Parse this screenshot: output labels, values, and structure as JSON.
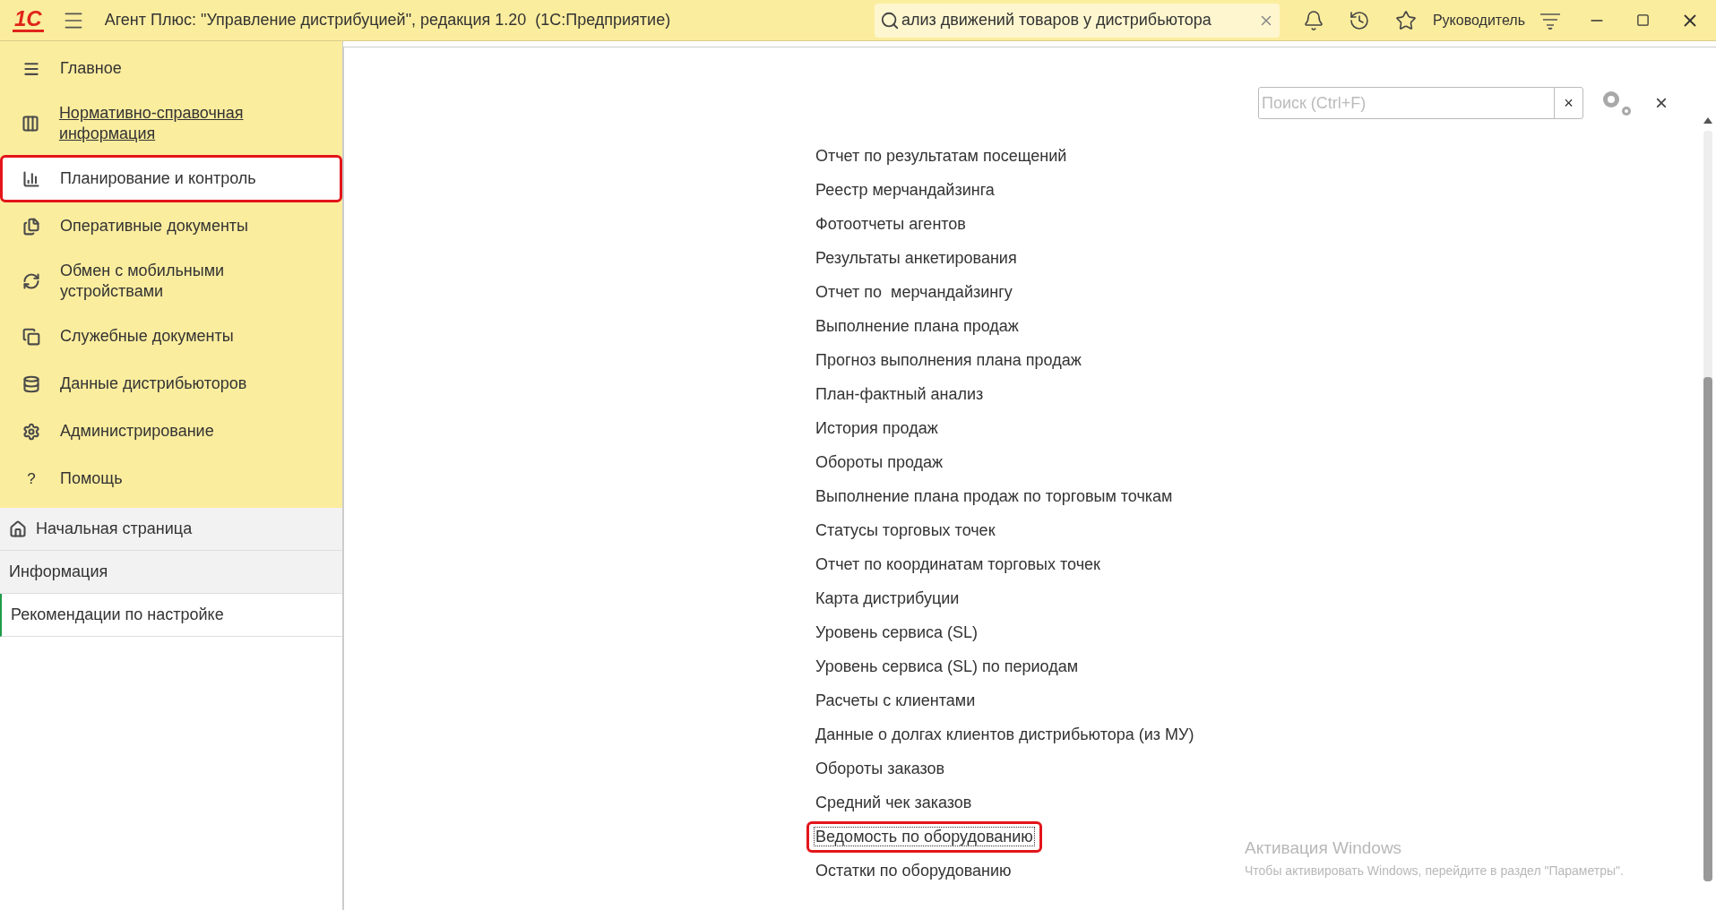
{
  "window": {
    "logo": "1С",
    "title": "Агент Плюс: \"Управление дистрибуцией\", редакция 1.20  (1С:Предприятие)",
    "search_value": "ализ движений товаров у дистрибьютора",
    "user": "Руководитель"
  },
  "sidebar": {
    "sections": [
      {
        "label": "Главное",
        "selected": false,
        "underlined": false,
        "highlighted": false
      },
      {
        "label": "Нормативно-справочная информация",
        "selected": false,
        "underlined": true,
        "highlighted": false
      },
      {
        "label": "Планирование и контроль",
        "selected": true,
        "underlined": false,
        "highlighted": true
      },
      {
        "label": "Оперативные документы",
        "selected": false,
        "underlined": false,
        "highlighted": false
      },
      {
        "label": "Обмен с мобильными устройствами",
        "selected": false,
        "underlined": false,
        "highlighted": false
      },
      {
        "label": "Служебные документы",
        "selected": false,
        "underlined": false,
        "highlighted": false
      },
      {
        "label": "Данные дистрибьюторов",
        "selected": false,
        "underlined": false,
        "highlighted": false
      },
      {
        "label": "Администрирование",
        "selected": false,
        "underlined": false,
        "highlighted": false
      },
      {
        "label": "Помощь",
        "glyph": "?",
        "selected": false,
        "underlined": false,
        "highlighted": false
      }
    ],
    "pages": [
      {
        "label": "Начальная страница",
        "selected": false
      },
      {
        "label": "Информация",
        "selected": false
      },
      {
        "label": "Рекомендации по настройке",
        "selected": true
      }
    ]
  },
  "panel": {
    "search_placeholder": "Поиск (Ctrl+F)",
    "clear_glyph": "×",
    "close_glyph": "×",
    "reports": [
      {
        "label": "Отчет по результатам посещений",
        "focused": false,
        "highlighted": false
      },
      {
        "label": "Реестр мерчандайзинга",
        "focused": false,
        "highlighted": false
      },
      {
        "label": "Фотоотчеты агентов",
        "focused": false,
        "highlighted": false
      },
      {
        "label": "Результаты анкетирования",
        "focused": false,
        "highlighted": false
      },
      {
        "label": "Отчет по  мерчандайзингу",
        "focused": false,
        "highlighted": false
      },
      {
        "label": "Выполнение плана продаж",
        "focused": false,
        "highlighted": false
      },
      {
        "label": "Прогноз выполнения плана продаж",
        "focused": false,
        "highlighted": false
      },
      {
        "label": "План-фактный анализ",
        "focused": false,
        "highlighted": false
      },
      {
        "label": "История продаж",
        "focused": false,
        "highlighted": false
      },
      {
        "label": "Обороты продаж",
        "focused": false,
        "highlighted": false
      },
      {
        "label": "Выполнение плана продаж по торговым точкам",
        "focused": false,
        "highlighted": false
      },
      {
        "label": "Статусы торговых точек",
        "focused": false,
        "highlighted": false
      },
      {
        "label": "Отчет по координатам торговых точек",
        "focused": false,
        "highlighted": false
      },
      {
        "label": "Карта дистрибуции",
        "focused": false,
        "highlighted": false
      },
      {
        "label": "Уровень сервиса (SL)",
        "focused": false,
        "highlighted": false
      },
      {
        "label": "Уровень сервиса (SL) по периодам",
        "focused": false,
        "highlighted": false
      },
      {
        "label": "Расчеты с клиентами",
        "focused": false,
        "highlighted": false
      },
      {
        "label": "Данные о долгах клиентов дистрибьютора (из МУ)",
        "focused": false,
        "highlighted": false
      },
      {
        "label": "Обороты заказов",
        "focused": false,
        "highlighted": false
      },
      {
        "label": "Средний чек заказов",
        "focused": false,
        "highlighted": false
      },
      {
        "label": "Ведомость по оборудованию",
        "focused": true,
        "highlighted": true
      },
      {
        "label": "Остатки по оборудованию",
        "focused": false,
        "highlighted": false
      }
    ]
  },
  "os_notice": {
    "title": "Активация Windows",
    "text": "Чтобы активировать Windows, перейдите в раздел \"Параметры\"."
  }
}
